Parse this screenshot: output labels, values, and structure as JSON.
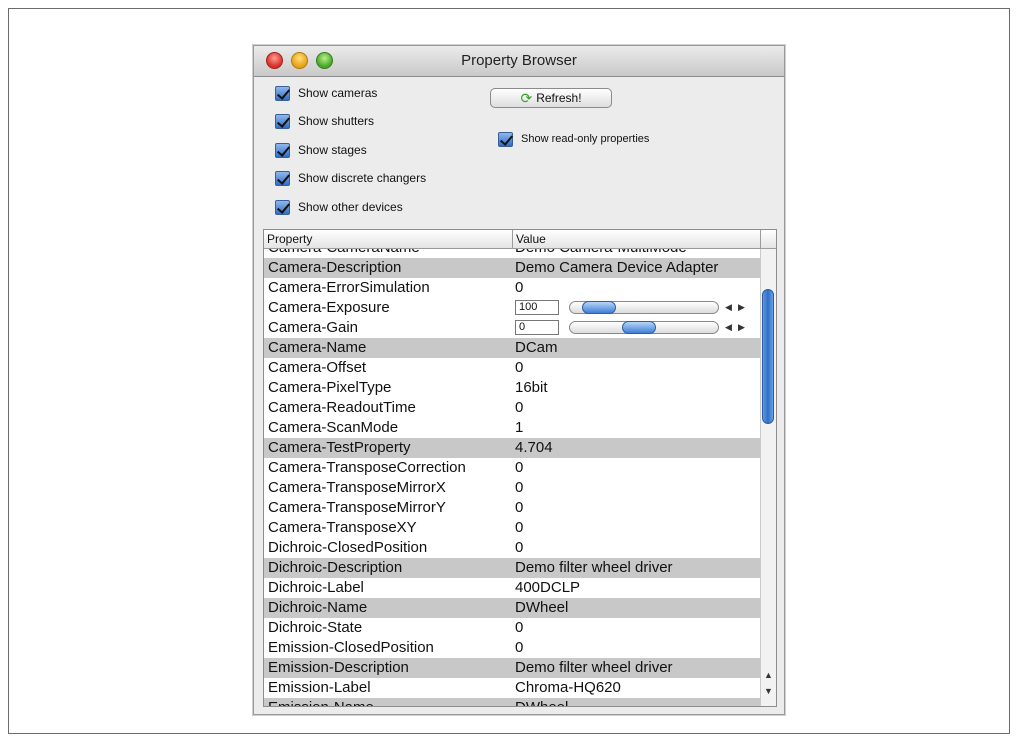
{
  "window": {
    "title": "Property Browser"
  },
  "options": {
    "show_cameras": "Show cameras",
    "show_shutters": "Show shutters",
    "show_stages": "Show stages",
    "show_discrete_changers": "Show discrete changers",
    "show_other_devices": "Show other devices",
    "refresh_label": "Refresh!",
    "show_read_only": "Show read-only properties"
  },
  "table": {
    "headers": {
      "property": "Property",
      "value": "Value"
    },
    "rows": [
      {
        "property": "Camera-CameraName",
        "value": "Demo Camera-MultiMode",
        "highlight": false
      },
      {
        "property": "Camera-Description",
        "value": "Demo Camera Device Adapter",
        "highlight": true
      },
      {
        "property": "Camera-ErrorSimulation",
        "value": "0",
        "highlight": false
      },
      {
        "property": "Camera-Exposure",
        "value": "100",
        "highlight": false,
        "slider": 0.1
      },
      {
        "property": "Camera-Gain",
        "value": "0",
        "highlight": false,
        "slider": 0.45
      },
      {
        "property": "Camera-Name",
        "value": "DCam",
        "highlight": true
      },
      {
        "property": "Camera-Offset",
        "value": "0",
        "highlight": false
      },
      {
        "property": "Camera-PixelType",
        "value": "16bit",
        "highlight": false
      },
      {
        "property": "Camera-ReadoutTime",
        "value": "0",
        "highlight": false
      },
      {
        "property": "Camera-ScanMode",
        "value": "1",
        "highlight": false
      },
      {
        "property": "Camera-TestProperty",
        "value": "4.704",
        "highlight": true
      },
      {
        "property": "Camera-TransposeCorrection",
        "value": "0",
        "highlight": false
      },
      {
        "property": "Camera-TransposeMirrorX",
        "value": "0",
        "highlight": false
      },
      {
        "property": "Camera-TransposeMirrorY",
        "value": "0",
        "highlight": false
      },
      {
        "property": "Camera-TransposeXY",
        "value": "0",
        "highlight": false
      },
      {
        "property": "Dichroic-ClosedPosition",
        "value": "0",
        "highlight": false
      },
      {
        "property": "Dichroic-Description",
        "value": "Demo filter wheel driver",
        "highlight": true
      },
      {
        "property": "Dichroic-Label",
        "value": "400DCLP",
        "highlight": false
      },
      {
        "property": "Dichroic-Name",
        "value": "DWheel",
        "highlight": true
      },
      {
        "property": "Dichroic-State",
        "value": "0",
        "highlight": false
      },
      {
        "property": "Emission-ClosedPosition",
        "value": "0",
        "highlight": false
      },
      {
        "property": "Emission-Description",
        "value": "Demo filter wheel driver",
        "highlight": true
      },
      {
        "property": "Emission-Label",
        "value": "Chroma-HQ620",
        "highlight": false
      },
      {
        "property": "Emission-Name",
        "value": "DWheel",
        "highlight": true
      }
    ]
  },
  "colors": {
    "row_highlight": "#c8c8c8",
    "accent": "#2f6dc8"
  },
  "icons": {
    "refresh": "refresh-icon",
    "checkbox": "checkmark-icon"
  }
}
